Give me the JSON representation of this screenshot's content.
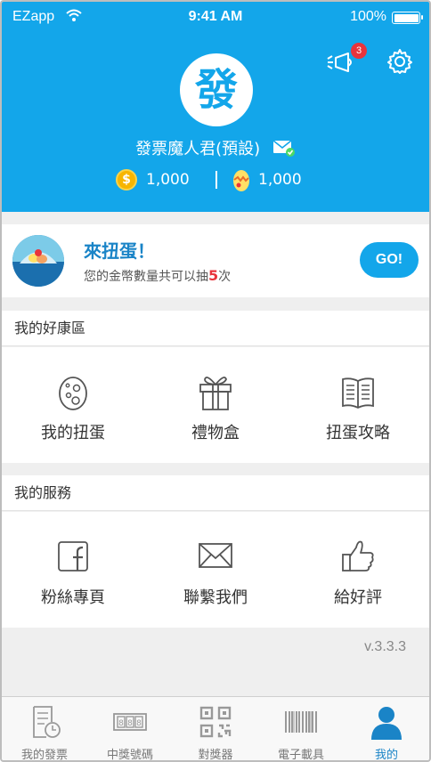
{
  "status_bar": {
    "carrier": "EZapp",
    "time": "9:41 AM",
    "battery": "100%"
  },
  "header": {
    "avatar_char": "發",
    "username": "發票魔人君(預設)",
    "notification_count": "3",
    "coins": "1,000",
    "eggs": "1,000",
    "background_color": "#13a6ea"
  },
  "gacha": {
    "title": "來扭蛋！",
    "desc_prefix": "您的金幣數量共可以抽",
    "desc_count": "5",
    "desc_suffix": "次",
    "go_label": "GO!"
  },
  "benefits": {
    "title": "我的好康區",
    "items": [
      {
        "label": "我的扭蛋",
        "icon": "egg-icon"
      },
      {
        "label": "禮物盒",
        "icon": "gift-icon"
      },
      {
        "label": "扭蛋攻略",
        "icon": "book-icon"
      }
    ]
  },
  "services": {
    "title": "我的服務",
    "items": [
      {
        "label": "粉絲專頁",
        "icon": "facebook-icon"
      },
      {
        "label": "聯繫我們",
        "icon": "envelope-icon"
      },
      {
        "label": "給好評",
        "icon": "thumbs-up-icon"
      }
    ]
  },
  "version": "v.3.3.3",
  "tabs": [
    {
      "label": "我的發票",
      "icon": "receipt-clock-icon"
    },
    {
      "label": "中獎號碼",
      "icon": "lottery-number-icon"
    },
    {
      "label": "對獎器",
      "icon": "qr-code-icon"
    },
    {
      "label": "電子載具",
      "icon": "barcode-icon"
    },
    {
      "label": "我的",
      "icon": "person-icon",
      "active": true
    }
  ]
}
